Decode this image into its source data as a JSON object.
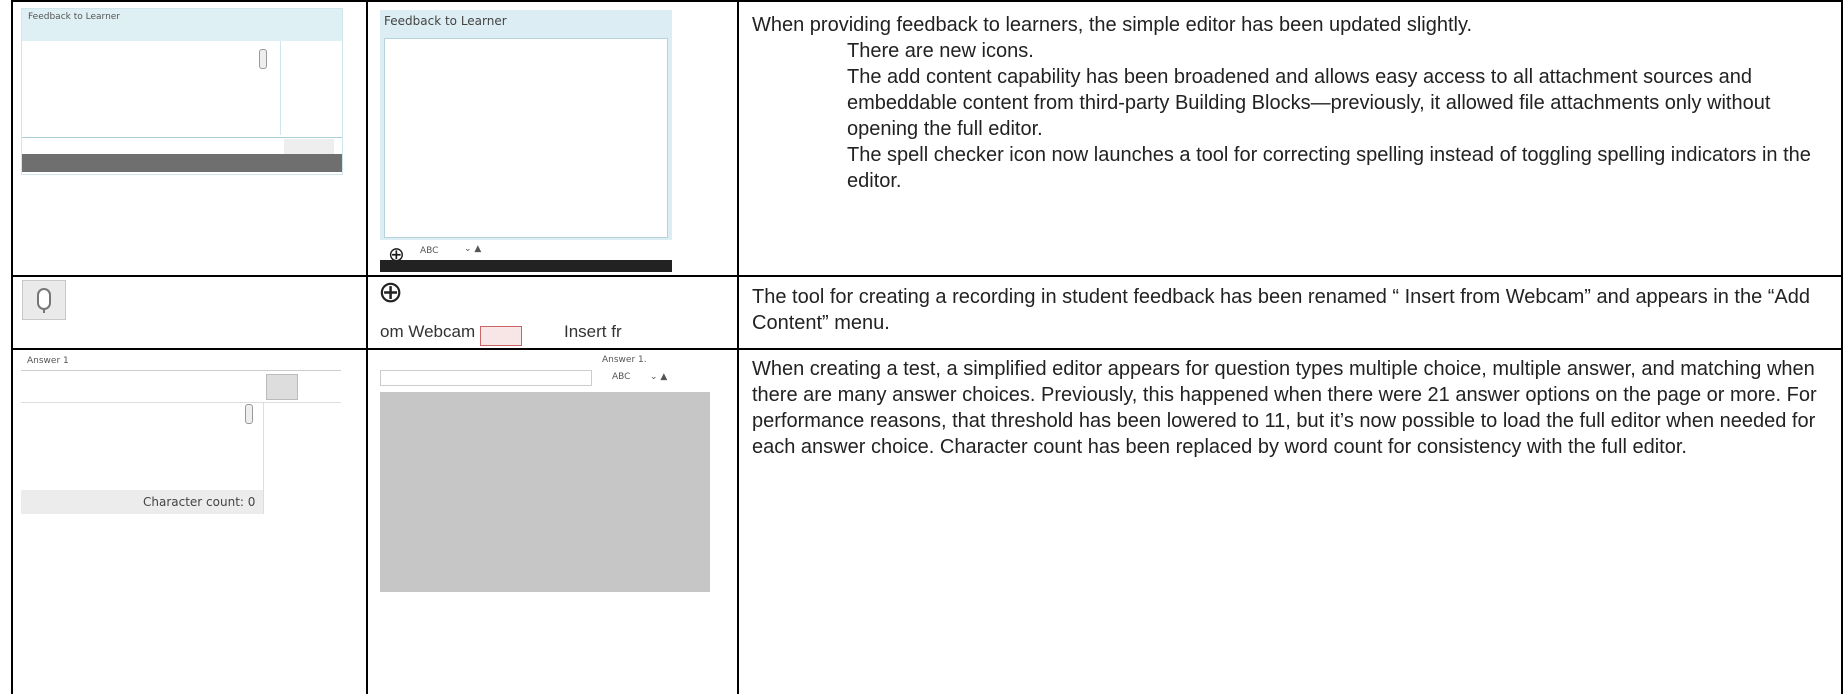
{
  "rows": [
    {
      "left_thumb": {
        "title": "Feedback to Learner"
      },
      "mid_thumb": {
        "title": "Feedback to Learner",
        "toolbar_text": "ABC"
      },
      "description": {
        "intro": "When providing feedback to learners, the simple editor has been updated slightly.",
        "points": [
          "There are new icons.",
          "The add content capability has been broadened and allows easy access to all attachment sources and embeddable content from third-party Building Blocks—previously, it allowed file attachments only without opening the full editor.",
          "The spell checker icon now launches a tool for correcting spelling instead of toggling spelling indicators in the editor."
        ]
      }
    },
    {
      "mid_thumb": {
        "menu_left": "om Webcam",
        "menu_right": "Insert fr"
      },
      "description": {
        "text": "The tool for creating a recording in student feedback has been renamed “ Insert from Webcam” and appears in the “Add Content” menu."
      }
    },
    {
      "left_thumb": {
        "title": "Answer 1",
        "char_count": "Character count: 0"
      },
      "mid_thumb": {
        "title": "Answer 1.",
        "toolbar_text": "ABC"
      },
      "description": {
        "text": "When creating a test, a simplified editor appears for question types multiple choice, multiple answer, and matching when there are many answer choices. Previously, this happened when there were 21 answer options on the page or more. For performance reasons, that threshold has been lowered to 11, but it’s now possible to load the full editor when needed for each answer choice. Character count has been replaced by word count for consistency with the full editor."
      }
    }
  ]
}
